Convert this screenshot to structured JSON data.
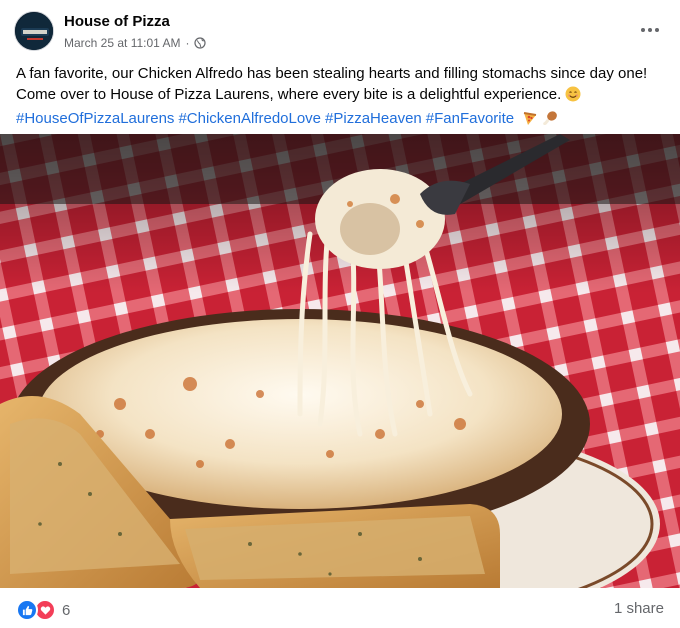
{
  "post": {
    "page_name": "House of Pizza",
    "avatar_text": "HouseofPizza",
    "timestamp": "March 25 at 11:01 AM",
    "separator": "·",
    "audience_icon": "globe-icon",
    "more_icon": "more-horizontal-icon",
    "caption_line1": "A fan favorite, our Chicken Alfredo has been stealing hearts and filling stomachs since day one!",
    "caption_line2": "Come over to House of Pizza Laurens, where every bite is a delightful experience.",
    "caption_emoji": "smiling-face-icon",
    "hashtags": [
      "#HouseOfPizzaLaurens",
      "#ChickenAlfredoLove",
      "#PizzaHeaven",
      "#FanFavorite"
    ],
    "hashtag_emojis": [
      "pizza-icon",
      "drumstick-icon"
    ],
    "photo_icon": "chicken-alfredo-photo"
  },
  "footer": {
    "reaction_icons": [
      "like-icon",
      "love-icon"
    ],
    "reaction_count": "6",
    "share_count": "1 share"
  },
  "colors": {
    "link": "#216fdb",
    "secondary_text": "#65676b",
    "like": "#1877f2",
    "love": "#f33e58"
  }
}
